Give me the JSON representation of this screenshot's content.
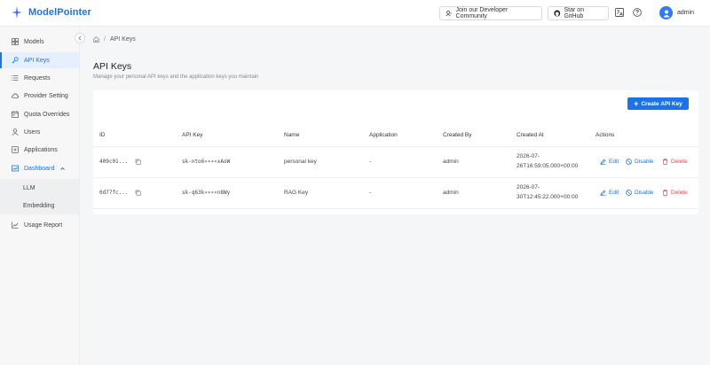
{
  "app": {
    "name": "ModelPointer"
  },
  "header": {
    "community_label": "Join our Developer Community",
    "github_label": "Star on GitHub",
    "user_name": "admin"
  },
  "sidebar": {
    "items": [
      {
        "label": "Models",
        "icon": "grid-icon"
      },
      {
        "label": "API Keys",
        "icon": "key-icon"
      },
      {
        "label": "Requests",
        "icon": "list-icon"
      },
      {
        "label": "Provider Setting",
        "icon": "cloud-icon"
      },
      {
        "label": "Quota Overrides",
        "icon": "calendar-icon"
      },
      {
        "label": "Users",
        "icon": "user-icon"
      },
      {
        "label": "Applications",
        "icon": "apps-icon"
      },
      {
        "label": "Dashboard",
        "icon": "dashboard-icon"
      },
      {
        "label": "Usage Report",
        "icon": "chart-icon"
      }
    ],
    "dashboard_children": [
      {
        "label": "LLM"
      },
      {
        "label": "Embedding"
      }
    ]
  },
  "breadcrumb": {
    "current": "API Keys",
    "separator": "/"
  },
  "page": {
    "title": "API Keys",
    "subtitle": "Manage your personal API keys and the application keys you maintain",
    "create_button_label": "Create API Key"
  },
  "table": {
    "columns": [
      "ID",
      "API Key",
      "Name",
      "Application",
      "Created By",
      "Created At",
      "Actions"
    ],
    "rows": [
      {
        "id": "409c01...",
        "api_key": "sk-nto6∗∗∗∗xAoW",
        "name": "personal key",
        "application": "-",
        "created_by": "admin",
        "created_at_line1": "2026-07-",
        "created_at_line2": "26T16:59:05.000+00:00"
      },
      {
        "id": "0d77fc...",
        "api_key": "sk-q63k∗∗∗∗n8Wy",
        "name": "RAG Key",
        "application": "-",
        "created_by": "admin",
        "created_at_line1": "2026-07-",
        "created_at_line2": "30T12:45:22.000+00:00"
      }
    ],
    "actions": {
      "edit": "Edit",
      "disable": "Disable",
      "delete": "Delete"
    }
  },
  "colors": {
    "accent": "#1a73e8",
    "danger": "#e5484d",
    "active_bg": "#e6effd"
  }
}
